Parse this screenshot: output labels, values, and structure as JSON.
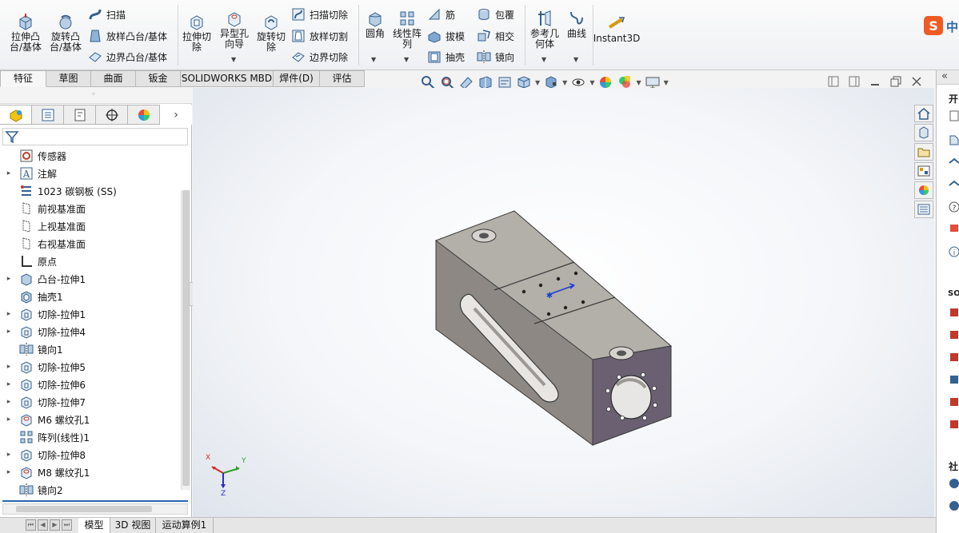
{
  "ribbon": {
    "extrude_boss": "拉伸凸\n台/基体",
    "revolve_boss": "旋转凸\n台/基体",
    "sweep": "扫描",
    "loft_boss": "放样凸台/基体",
    "boundary_boss": "边界凸台/基体",
    "extrude_cut": "拉伸切\n除",
    "hole_wizard": "异型孔\n向导",
    "revolve_cut": "旋转切\n除",
    "swept_cut": "扫描切除",
    "lofted_cut": "放样切割",
    "boundary_cut": "边界切除",
    "fillet": "圆角",
    "linear_pattern": "线性阵\n列",
    "rib": "筋",
    "draft": "拔模",
    "shell": "抽壳",
    "wrap": "包覆",
    "intersect": "相交",
    "mirror": "镜向",
    "ref_geometry": "参考几\n何体",
    "curves": "曲线",
    "instant3d": "Instant3D",
    "ime_label": "中"
  },
  "tabs": [
    "特征",
    "草图",
    "曲面",
    "钣金",
    "SOLIDWORKS MBD",
    "焊件(D)",
    "评估"
  ],
  "tree": {
    "items": [
      {
        "label": "传感器",
        "icon": "sensor-icon",
        "expand": ""
      },
      {
        "label": "注解",
        "icon": "annotation-icon",
        "expand": "▸"
      },
      {
        "label": "1023 碳钢板 (SS)",
        "icon": "material-icon",
        "expand": ""
      },
      {
        "label": "前视基准面",
        "icon": "plane-icon",
        "expand": ""
      },
      {
        "label": "上视基准面",
        "icon": "plane-icon",
        "expand": ""
      },
      {
        "label": "右视基准面",
        "icon": "plane-icon",
        "expand": ""
      },
      {
        "label": "原点",
        "icon": "origin-icon",
        "expand": ""
      },
      {
        "label": "凸台-拉伸1",
        "icon": "boss-extrude-icon",
        "expand": "▸"
      },
      {
        "label": "抽壳1",
        "icon": "shell-icon",
        "expand": ""
      },
      {
        "label": "切除-拉伸1",
        "icon": "cut-extrude-icon",
        "expand": "▸"
      },
      {
        "label": "切除-拉伸4",
        "icon": "cut-extrude-icon",
        "expand": "▸"
      },
      {
        "label": "镜向1",
        "icon": "mirror-icon",
        "expand": ""
      },
      {
        "label": "切除-拉伸5",
        "icon": "cut-extrude-icon",
        "expand": "▸"
      },
      {
        "label": "切除-拉伸6",
        "icon": "cut-extrude-icon",
        "expand": "▸"
      },
      {
        "label": "切除-拉伸7",
        "icon": "cut-extrude-icon",
        "expand": "▸"
      },
      {
        "label": "M6 螺纹孔1",
        "icon": "hole-icon",
        "expand": "▸"
      },
      {
        "label": "阵列(线性)1",
        "icon": "pattern-icon",
        "expand": ""
      },
      {
        "label": "切除-拉伸8",
        "icon": "cut-extrude-icon",
        "expand": "▸"
      },
      {
        "label": "M8 螺纹孔1",
        "icon": "hole-icon",
        "expand": "▸"
      },
      {
        "label": "镜向2",
        "icon": "mirror-icon",
        "expand": ""
      }
    ]
  },
  "triad": {
    "x": "X",
    "y": "Y",
    "z": "Z"
  },
  "right_pane": {
    "label_kai": "开",
    "label_sol": "SOL",
    "label_she": "社"
  },
  "bottom_tabs": {
    "model": "模型",
    "view3d": "3D 视图",
    "motion": "运动算例1"
  },
  "colors": {
    "part_face_light": "#a9a49e",
    "part_face_top": "#b5b1ab",
    "part_face_dark": "#7a7570",
    "end_face": "#6a6072",
    "accent_blue": "#2a66b0"
  }
}
